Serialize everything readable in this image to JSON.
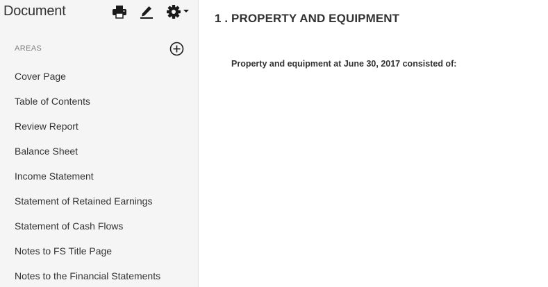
{
  "sidebar": {
    "title": "Document",
    "header_icons": [
      "printer-icon",
      "pencil-icon",
      "gear-icon",
      "caret-down-icon"
    ],
    "areas_label": "AREAS",
    "add_icon": "plus-circle-icon",
    "items": [
      {
        "label": "Cover Page"
      },
      {
        "label": "Table of Contents"
      },
      {
        "label": "Review Report"
      },
      {
        "label": "Balance Sheet"
      },
      {
        "label": "Income Statement"
      },
      {
        "label": "Statement of Retained Earnings"
      },
      {
        "label": "Statement of Cash Flows"
      },
      {
        "label": "Notes to FS Title Page"
      },
      {
        "label": "Notes to the Financial Statements"
      }
    ]
  },
  "main": {
    "heading": "1 . PROPERTY AND EQUIPMENT",
    "paragraph": "Property and equipment at June 30, 2017 consisted of:"
  },
  "colors": {
    "sidebar_bg": "#f5f5f5",
    "text": "#333333",
    "muted": "#808080",
    "icon": "#1a1a1a"
  }
}
